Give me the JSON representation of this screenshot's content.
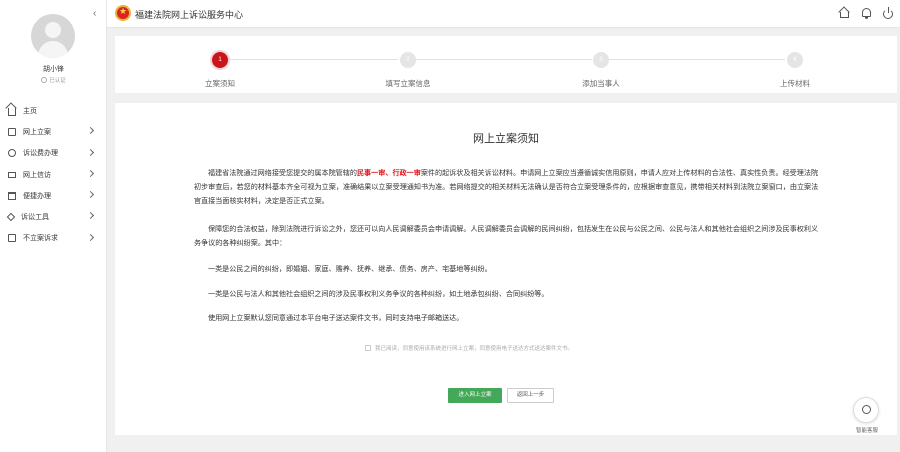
{
  "app": {
    "title": "福建法院网上诉讼服务中心"
  },
  "user": {
    "name": "胡小锋",
    "status": "已认证"
  },
  "sidebar": {
    "items": [
      {
        "label": "主页",
        "icon": "home-icon",
        "has_arrow": false
      },
      {
        "label": "网上立案",
        "icon": "document-icon",
        "has_arrow": true
      },
      {
        "label": "诉讼费办理",
        "icon": "fee-icon",
        "has_arrow": true
      },
      {
        "label": "网上信访",
        "icon": "mail-icon",
        "has_arrow": true
      },
      {
        "label": "便捷办理",
        "icon": "calendar-icon",
        "has_arrow": true
      },
      {
        "label": "诉讼工具",
        "icon": "tool-icon",
        "has_arrow": true
      },
      {
        "label": "不立案诉求",
        "icon": "no-case-icon",
        "has_arrow": true
      }
    ]
  },
  "steps": [
    {
      "num": "1",
      "label": "立案须知",
      "active": true
    },
    {
      "num": "2",
      "label": "填写立案信息",
      "active": false
    },
    {
      "num": "3",
      "label": "添加当事人",
      "active": false
    },
    {
      "num": "4",
      "label": "上传材料",
      "active": false
    }
  ],
  "notice": {
    "title": "网上立案须知",
    "p1_a": "福建省法院通过网络接受您提交的属本院管辖的",
    "p1_red1": "民事一审",
    "p1_sep": "、",
    "p1_red2": "行政一审",
    "p1_b": "案件的起诉状及相关诉讼材料。申请网上立案应当遵循诚实信用原则，申请人应对上传材料的合法性、真实性负责。经受理法院初步审查后，若您的材料基本齐全可视为立案，准确结果以立案受理通知书为准。若网络提交的相关材料无法确认是否符合立案受理条件的，应根据审查意见，携带相关材料到法院立案窗口，由立案法官直接当面核实材料，决定是否正式立案。",
    "p2": "保障您的合法权益，除到法院进行诉讼之外，您还可以向人民调解委员会申请调解。人民调解委员会调解的民间纠纷，包括发生在公民与公民之间、公民与法人和其他社会组织之间涉及民事权利义务争议的各种纠纷案。其中：",
    "p3": "一类是公民之间的纠纷，即婚姻、家庭、赡养、抚养、继承、债务、房产、宅基地等纠纷。",
    "p4": "一类是公民与法人和其他社会组织之间的涉及民事权利义务争议的各种纠纷，如土地承包纠纷、合同纠纷等。",
    "p5": "使用网上立案默认您同意通过本平台电子送达案件文书，同时支持电子邮箱送达。"
  },
  "agree_text": "我已阅读，同意使用该系统进行网上立案，同意使用电子送达方式送达案件文书。",
  "buttons": {
    "enter": "进入网上立案",
    "back": "返回上一步"
  },
  "assistant": {
    "label": "智能客服"
  },
  "colors": {
    "accent_red": "#c9161b",
    "green": "#43a858"
  }
}
